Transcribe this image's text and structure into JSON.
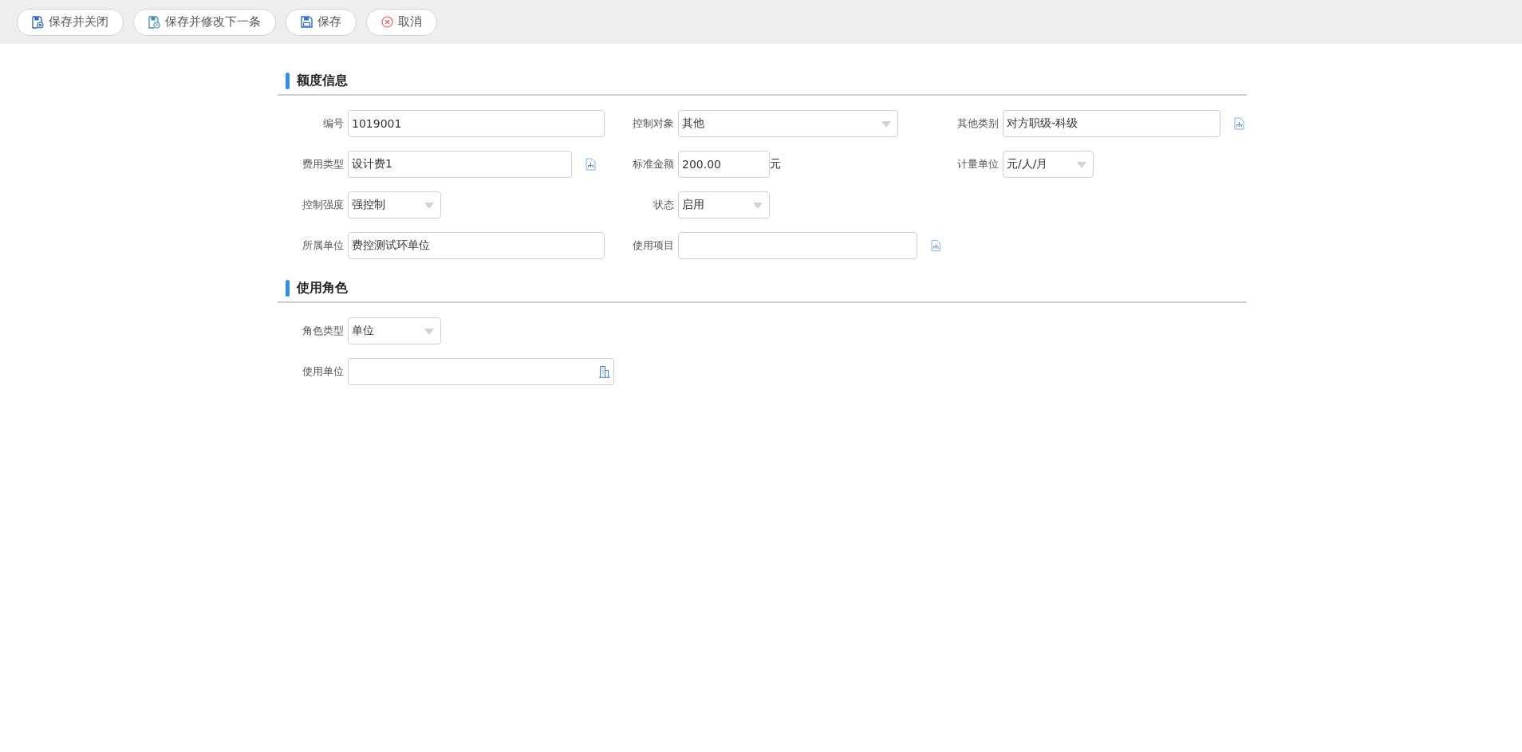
{
  "toolbar": [
    {
      "kind": "save-close",
      "label": "保存并关闭"
    },
    {
      "kind": "save-next",
      "label": "保存并修改下一条"
    },
    {
      "kind": "save",
      "label": "保存"
    },
    {
      "kind": "cancel",
      "label": "取消"
    }
  ],
  "sections": [
    {
      "title": "额度信息",
      "rows": [
        [
          {
            "label": "编号",
            "kind": "text",
            "value": "1019001"
          },
          {
            "label": "控制对象",
            "kind": "select",
            "value": "其他"
          },
          {
            "label": "其他类别",
            "kind": "lookup",
            "value": "对方职级-科级"
          }
        ],
        [
          {
            "label": "费用类型",
            "kind": "lookup",
            "value": "设计费1"
          },
          {
            "label": "标准金额",
            "kind": "text",
            "value": "200.00",
            "unit": "元"
          },
          {
            "label": "计量单位",
            "kind": "select",
            "value": "元/人/月"
          }
        ],
        [
          {
            "label": "控制强度",
            "kind": "select",
            "value": "强控制"
          },
          {
            "label": "状态",
            "kind": "select",
            "value": "启用"
          }
        ],
        [
          {
            "label": "所属单位",
            "kind": "text",
            "value": "费控测试环单位"
          },
          {
            "label": "使用项目",
            "kind": "lookup"
          }
        ]
      ]
    },
    {
      "title": "使用角色",
      "rows": [
        [
          {
            "label": "角色类型",
            "kind": "select",
            "value": "单位"
          }
        ],
        [
          {
            "label": "使用单位",
            "kind": "org"
          }
        ]
      ]
    }
  ]
}
